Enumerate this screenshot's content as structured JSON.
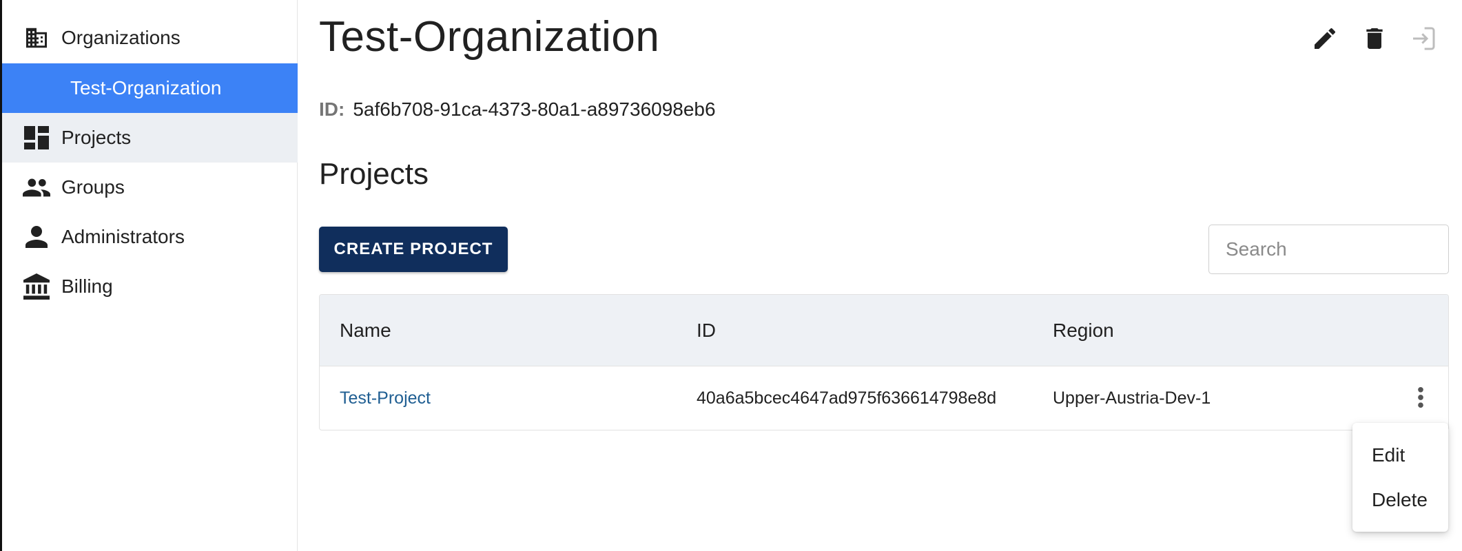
{
  "sidebar": {
    "items": [
      {
        "label": "Organizations",
        "icon": "building-icon"
      },
      {
        "label": "Test-Organization"
      },
      {
        "label": "Projects",
        "icon": "dashboard-icon"
      },
      {
        "label": "Groups",
        "icon": "people-icon"
      },
      {
        "label": "Administrators",
        "icon": "person-icon"
      },
      {
        "label": "Billing",
        "icon": "bank-icon"
      }
    ]
  },
  "header": {
    "title": "Test-Organization",
    "actions": [
      "edit-icon",
      "delete-icon",
      "exit-icon"
    ]
  },
  "org": {
    "id_label": "ID:",
    "id_value": "5af6b708-91ca-4373-80a1-a89736098eb6"
  },
  "projects": {
    "title": "Projects",
    "create_label": "CREATE PROJECT",
    "search_placeholder": "Search",
    "columns": [
      "Name",
      "ID",
      "Region"
    ],
    "rows": [
      {
        "name": "Test-Project",
        "id": "40a6a5bcec4647ad975f636614798e8d",
        "region": "Upper-Austria-Dev-1"
      }
    ]
  },
  "row_menu": {
    "items": [
      "Edit",
      "Delete"
    ]
  },
  "colors": {
    "active_nav": "#3c82f6",
    "hover_nav": "#eceff3",
    "primary_button": "#102e5c",
    "link": "#1f5e92",
    "table_header": "#eef1f5"
  }
}
